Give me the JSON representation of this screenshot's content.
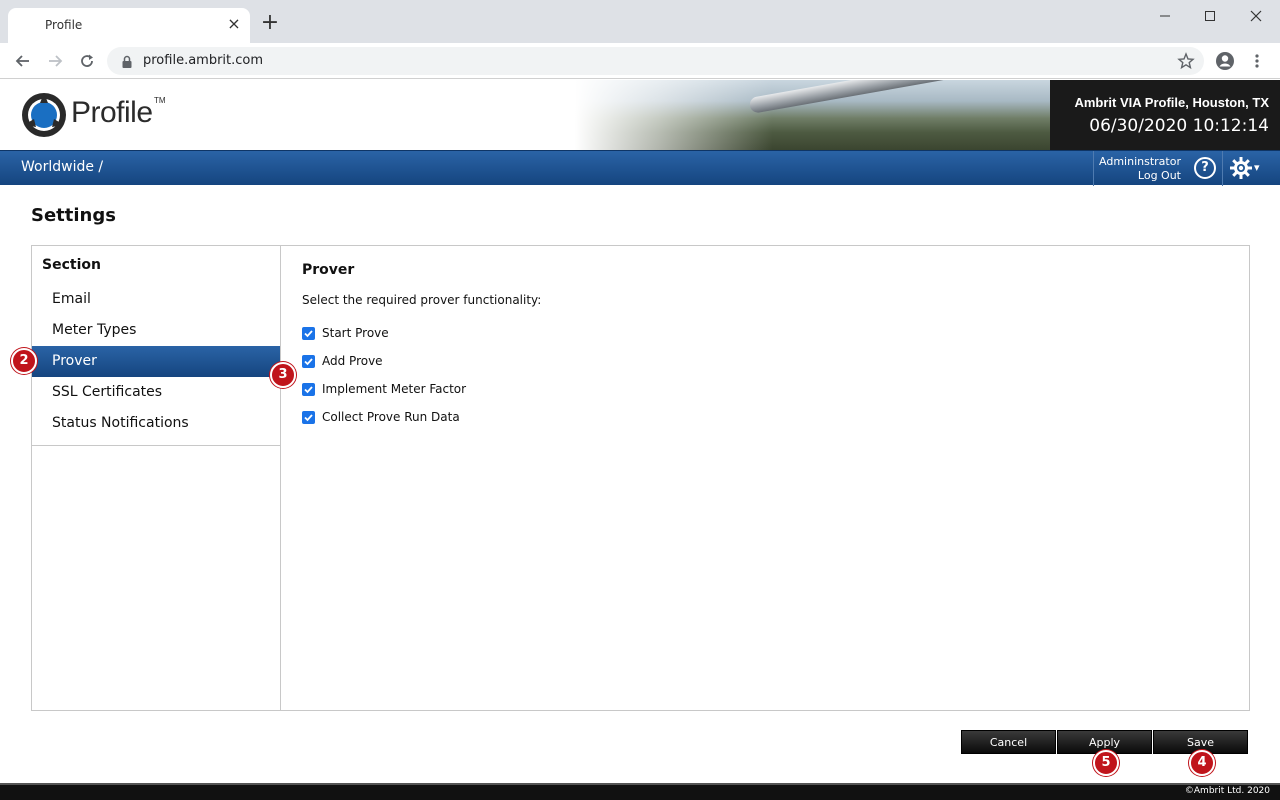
{
  "browser": {
    "tab_title": "Profile",
    "tab_close": "×",
    "new_tab": "+",
    "url": "profile.ambrit.com"
  },
  "header": {
    "logo_text": "Profile",
    "logo_tm": "TM",
    "site_name": "Ambrit VIA Profile, Houston, TX",
    "clock": "06/30/2020 10:12:14"
  },
  "nav": {
    "breadcrumb": "Worldwide /",
    "user_name": "Admininstrator",
    "logout": "Log Out",
    "help": "?",
    "caret": "▾"
  },
  "page": {
    "title": "Settings"
  },
  "sidebar": {
    "heading": "Section",
    "items": [
      {
        "label": "Email",
        "active": false
      },
      {
        "label": "Meter Types",
        "active": false
      },
      {
        "label": "Prover",
        "active": true
      },
      {
        "label": "SSL Certificates",
        "active": false
      },
      {
        "label": "Status Notifications",
        "active": false
      }
    ]
  },
  "content": {
    "title": "Prover",
    "description": "Select the required prover functionality:",
    "options": [
      {
        "label": "Start Prove",
        "checked": true
      },
      {
        "label": "Add Prove",
        "checked": true
      },
      {
        "label": "Implement Meter Factor",
        "checked": true
      },
      {
        "label": "Collect Prove Run Data",
        "checked": true
      }
    ]
  },
  "buttons": {
    "cancel": "Cancel",
    "apply": "Apply",
    "save": "Save"
  },
  "callouts": {
    "c2": "2",
    "c3": "3",
    "c4": "4",
    "c5": "5"
  },
  "footer": {
    "copyright": "©Ambrit Ltd. 2020"
  },
  "colors": {
    "nav_blue": "#15457f",
    "accent_blue": "#1a73e8",
    "callout_red": "#c0141b"
  }
}
